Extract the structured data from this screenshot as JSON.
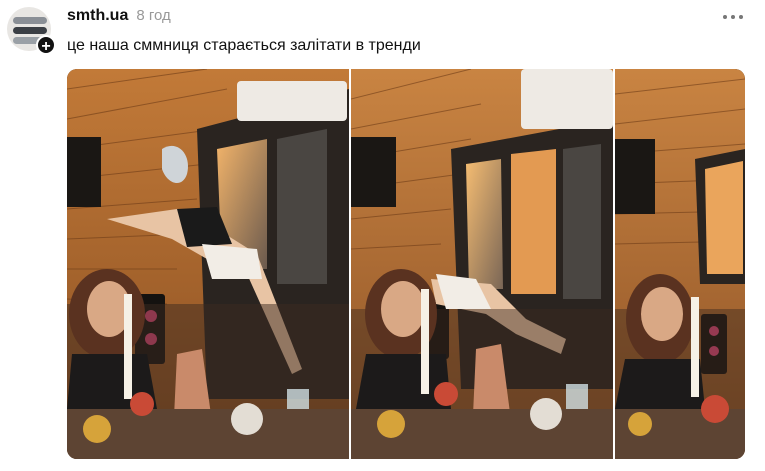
{
  "post": {
    "username": "smth.ua",
    "time": "8 год",
    "caption": "це наша сммниця старається залітати в тренди"
  },
  "icons": {
    "follow": "plus-icon",
    "menu": "more-horizontal-icon"
  },
  "follow_symbol": "+",
  "media": {
    "frames": 3
  }
}
